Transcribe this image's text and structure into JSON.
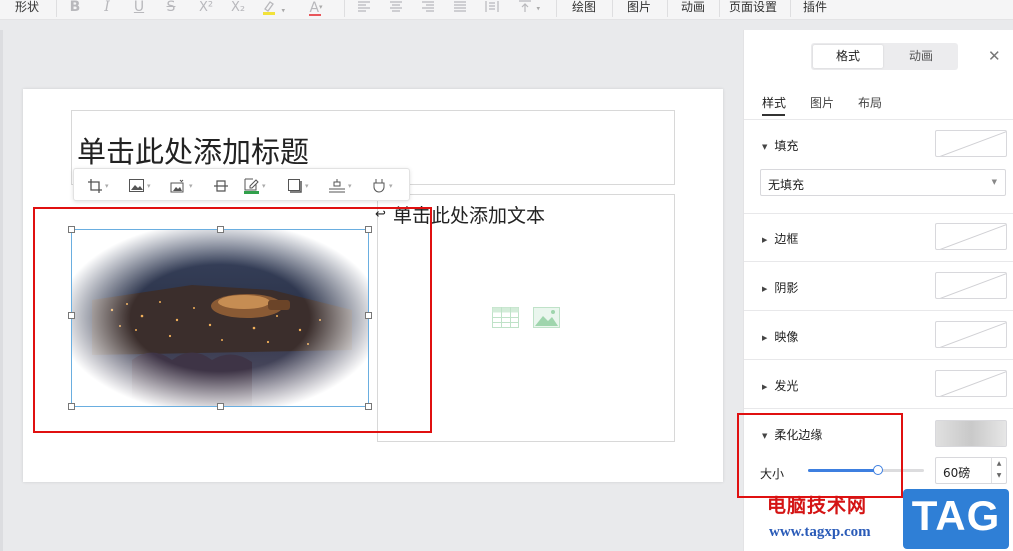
{
  "toolbar": {
    "shape_label": "形状",
    "bold": "B",
    "italic": "I",
    "underline": "U",
    "strike": "S",
    "superscript": "X²",
    "subscript": "X₂",
    "font_color": "A",
    "draw_label": "绘图",
    "picture_label": "图片",
    "animation_label": "动画",
    "page_setup_label": "页面设置",
    "plugin_label": "插件"
  },
  "slide": {
    "title_placeholder": "单击此处添加标题",
    "body_placeholder": "单击此处添加文本"
  },
  "pane": {
    "tabs": {
      "format": "格式",
      "animation": "动画"
    },
    "subtabs": {
      "style": "样式",
      "picture": "图片",
      "layout": "布局"
    },
    "fill": {
      "label": "填充",
      "option": "无填充"
    },
    "border": "边框",
    "shadow": "阴影",
    "reflection": "映像",
    "glow": "发光",
    "soft_edges": {
      "label": "柔化边缘",
      "size_label": "大小",
      "size_value": "60磅",
      "slider_fraction": 0.6
    }
  },
  "watermark": {
    "cn": "电脑技术网",
    "url": "www.tagxp.com",
    "tag": "TAG"
  },
  "colors": {
    "accent": "#3d7fe0",
    "highlight_red": "#e01010",
    "selection_blue": "#6aaee0"
  }
}
